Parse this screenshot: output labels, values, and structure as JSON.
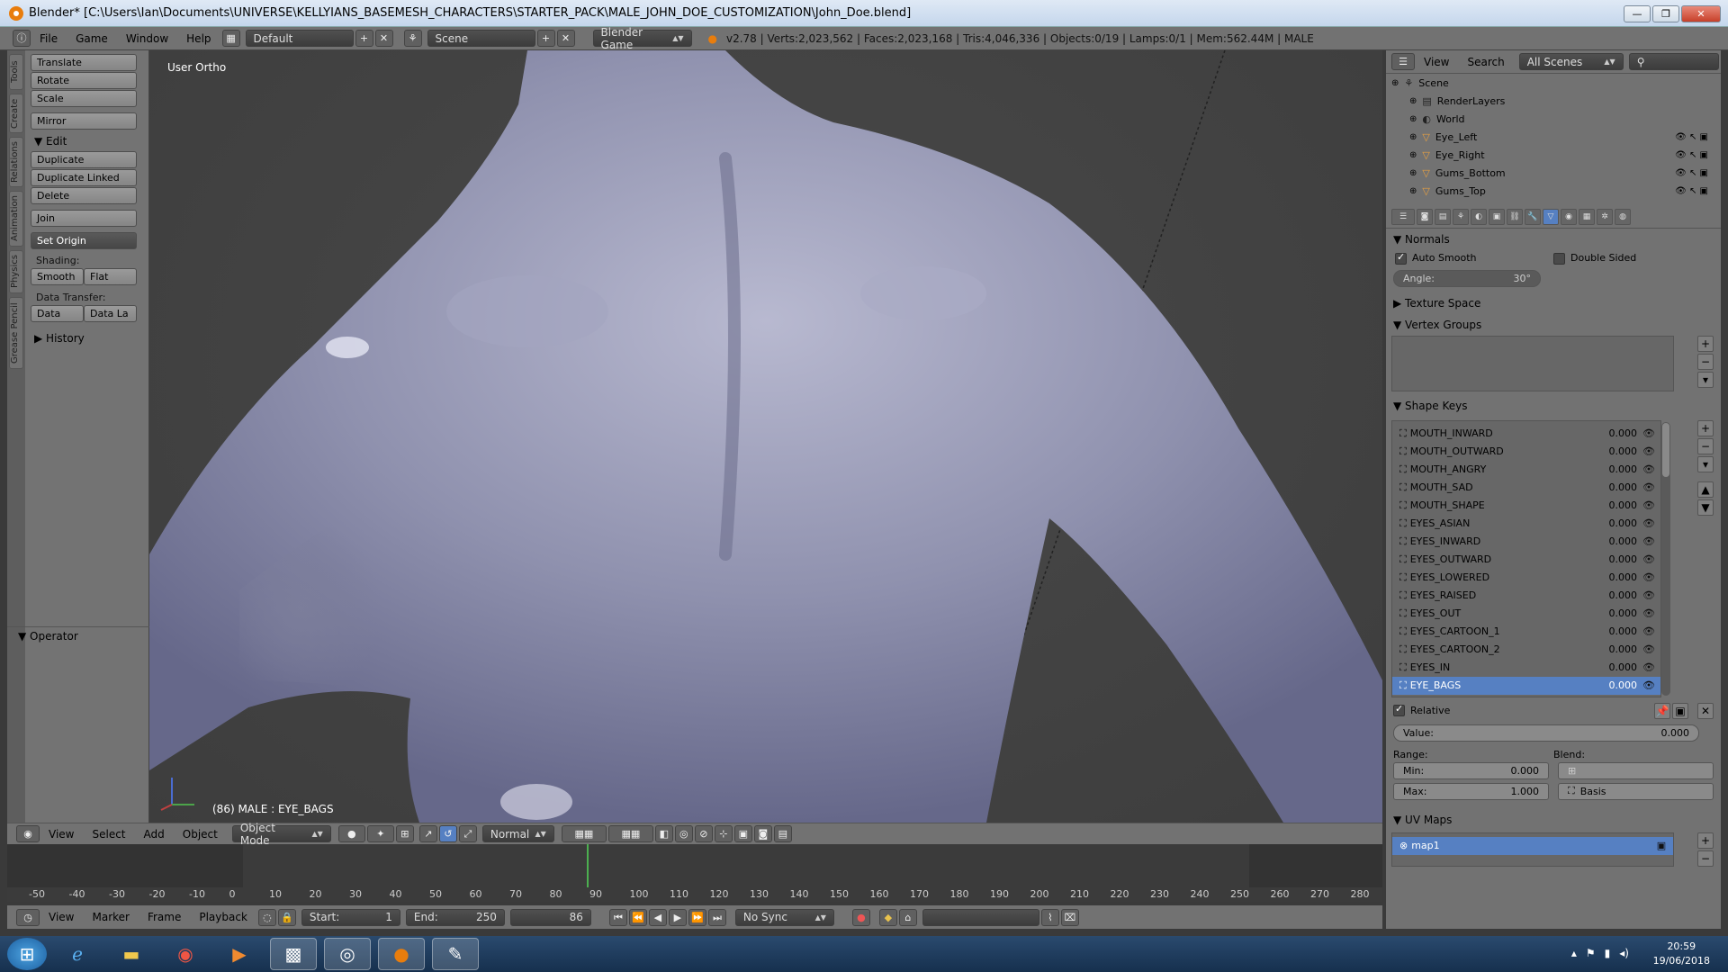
{
  "window": {
    "title": "Blender* [C:\\Users\\Ian\\Documents\\UNIVERSE\\KELLYIANS_BASEMESH_CHARACTERS\\STARTER_PACK\\MALE_JOHN_DOE_CUSTOMIZATION\\John_Doe.blend]",
    "minimize": "—",
    "maximize": "❐",
    "close": "✕"
  },
  "topbar": {
    "menus": [
      "File",
      "Game",
      "Window",
      "Help"
    ],
    "layout": "Default",
    "scene": "Scene",
    "engine": "Blender Game",
    "stats": "v2.78 | Verts:2,023,562 | Faces:2,023,168 | Tris:4,046,336 | Objects:0/19 | Lamps:0/1 | Mem:562.44M | MALE"
  },
  "tool_tabs": [
    "Tools",
    "Create",
    "Relations",
    "Animation",
    "Physics",
    "Grease Pencil"
  ],
  "toolshelf": {
    "transform": [
      "Translate",
      "Rotate",
      "Scale"
    ],
    "mirror": "Mirror",
    "edit_header": "Edit",
    "edit": [
      "Duplicate",
      "Duplicate Linked",
      "Delete"
    ],
    "join": "Join",
    "set_origin": "Set Origin",
    "shading_label": "Shading:",
    "smooth": "Smooth",
    "flat": "Flat",
    "data_transfer_label": "Data Transfer:",
    "data": "Data",
    "data_la": "Data La",
    "history": "History",
    "operator": "Operator"
  },
  "viewport": {
    "label": "User Ortho",
    "object_info": "(86) MALE : EYE_BAGS"
  },
  "viewport_header": {
    "menus": [
      "View",
      "Select",
      "Add",
      "Object"
    ],
    "mode": "Object Mode",
    "pivot": "Normal"
  },
  "timeline": {
    "ticks": [
      "-50",
      "-40",
      "-30",
      "-20",
      "-10",
      "0",
      "10",
      "20",
      "30",
      "40",
      "50",
      "60",
      "70",
      "80",
      "90",
      "100",
      "110",
      "120",
      "130",
      "140",
      "150",
      "160",
      "170",
      "180",
      "190",
      "200",
      "210",
      "220",
      "230",
      "240",
      "250",
      "260",
      "270",
      "280"
    ],
    "menus": [
      "View",
      "Marker",
      "Frame",
      "Playback"
    ],
    "start_label": "Start:",
    "start": "1",
    "end_label": "End:",
    "end": "250",
    "current": "86",
    "sync": "No Sync"
  },
  "outliner": {
    "menus": [
      "View",
      "Search"
    ],
    "filter": "All Scenes",
    "rows": [
      {
        "name": "Scene",
        "indent": 0
      },
      {
        "name": "RenderLayers",
        "indent": 1
      },
      {
        "name": "World",
        "indent": 1
      },
      {
        "name": "Eye_Left",
        "indent": 1
      },
      {
        "name": "Eye_Right",
        "indent": 1
      },
      {
        "name": "Gums_Bottom",
        "indent": 1
      },
      {
        "name": "Gums_Top",
        "indent": 1
      }
    ]
  },
  "properties": {
    "normals": "Normals",
    "auto_smooth": "Auto Smooth",
    "double_sided": "Double Sided",
    "angle_label": "Angle:",
    "angle": "30°",
    "texture_space": "Texture Space",
    "vertex_groups": "Vertex Groups",
    "shape_keys_header": "Shape Keys",
    "shape_keys": [
      {
        "name": "MOUTH_INWARD",
        "value": "0.000"
      },
      {
        "name": "MOUTH_OUTWARD",
        "value": "0.000"
      },
      {
        "name": "MOUTH_ANGRY",
        "value": "0.000"
      },
      {
        "name": "MOUTH_SAD",
        "value": "0.000"
      },
      {
        "name": "MOUTH_SHAPE",
        "value": "0.000"
      },
      {
        "name": "EYES_ASIAN",
        "value": "0.000"
      },
      {
        "name": "EYES_INWARD",
        "value": "0.000"
      },
      {
        "name": "EYES_OUTWARD",
        "value": "0.000"
      },
      {
        "name": "EYES_LOWERED",
        "value": "0.000"
      },
      {
        "name": "EYES_RAISED",
        "value": "0.000"
      },
      {
        "name": "EYES_OUT",
        "value": "0.000"
      },
      {
        "name": "EYES_CARTOON_1",
        "value": "0.000"
      },
      {
        "name": "EYES_CARTOON_2",
        "value": "0.000"
      },
      {
        "name": "EYES_IN",
        "value": "0.000"
      },
      {
        "name": "EYE_BAGS",
        "value": "0.000",
        "selected": true
      }
    ],
    "relative": "Relative",
    "value_label": "Value:",
    "value": "0.000",
    "range_label": "Range:",
    "blend_label": "Blend:",
    "min_label": "Min:",
    "min": "0.000",
    "max_label": "Max:",
    "max": "1.000",
    "basis": "Basis",
    "uv_maps": "UV Maps",
    "uv_map": "map1"
  },
  "taskbar": {
    "time": "20:59",
    "date": "19/06/2018"
  },
  "colors": {
    "selected": "#5680c2",
    "panel": "#727272",
    "viewport": "#3d3d3d",
    "timeline_marker": "#4caf50"
  }
}
